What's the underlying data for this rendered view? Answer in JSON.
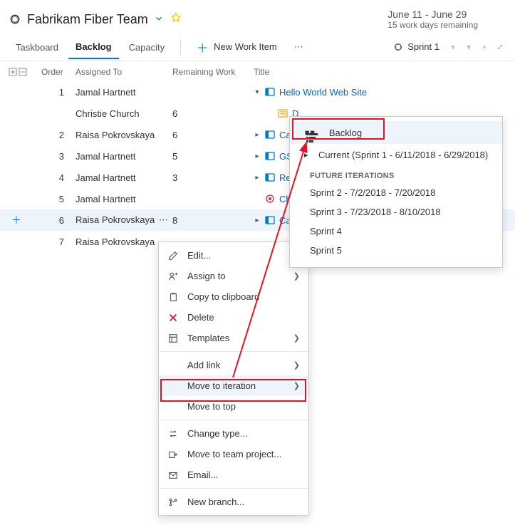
{
  "header": {
    "team_name": "Fabrikam Fiber Team",
    "date_range": "June 11 - June 29",
    "days_remaining": "15 work days remaining"
  },
  "tabs": {
    "taskboard": "Taskboard",
    "backlog": "Backlog",
    "capacity": "Capacity"
  },
  "toolbar": {
    "new_item": "New Work Item",
    "sprint": "Sprint 1"
  },
  "columns": {
    "order": "Order",
    "assigned": "Assigned To",
    "remaining": "Remaining Work",
    "title": "Title"
  },
  "rows": [
    {
      "order": "1",
      "assigned": "Jamal Hartnett",
      "remaining": "",
      "title": "Hello World Web Site",
      "caret": "▾",
      "icon": "blue",
      "link": true,
      "indent": 0
    },
    {
      "order": "",
      "assigned": "Christie Church",
      "remaining": "6",
      "title": "D",
      "caret": "",
      "icon": "yellow",
      "link": true,
      "indent": 1
    },
    {
      "order": "2",
      "assigned": "Raisa Pokrovskaya",
      "remaining": "6",
      "title": "Car",
      "caret": "▸",
      "icon": "blue",
      "link": true,
      "indent": 0
    },
    {
      "order": "3",
      "assigned": "Jamal Hartnett",
      "remaining": "5",
      "title": "GSF",
      "caret": "▸",
      "icon": "blue",
      "link": true,
      "indent": 0
    },
    {
      "order": "4",
      "assigned": "Jamal Hartnett",
      "remaining": "3",
      "title": "Re",
      "caret": "▸",
      "icon": "blue",
      "link": true,
      "indent": 0
    },
    {
      "order": "5",
      "assigned": "Jamal Hartnett",
      "remaining": "",
      "title": "Che",
      "caret": "",
      "icon": "red",
      "link": true,
      "indent": 0
    },
    {
      "order": "6",
      "assigned": "Raisa Pokrovskaya",
      "remaining": "8",
      "title": "Car",
      "caret": "▸",
      "icon": "blue",
      "link": true,
      "indent": 0,
      "selected": true,
      "showDots": true,
      "showPlus": true
    },
    {
      "order": "7",
      "assigned": "Raisa Pokrovskaya",
      "remaining": "",
      "title": "",
      "caret": "",
      "icon": "",
      "link": false,
      "indent": 0
    }
  ],
  "ctx": {
    "edit": "Edit...",
    "assign": "Assign to",
    "copy": "Copy to clipboard",
    "delete": "Delete",
    "templates": "Templates",
    "addlink": "Add link",
    "move_iter": "Move to iteration",
    "move_top": "Move to top",
    "change_type": "Change type...",
    "move_project": "Move to team project...",
    "email": "Email...",
    "new_branch": "New branch..."
  },
  "fly": {
    "backlog": "Backlog",
    "current": "Current (Sprint 1 - 6/11/2018 - 6/29/2018)",
    "future_head": "FUTURE ITERATIONS",
    "s2": "Sprint 2 - 7/2/2018 - 7/20/2018",
    "s3": "Sprint 3 - 7/23/2018 - 8/10/2018",
    "s4": "Sprint 4",
    "s5": "Sprint 5"
  }
}
